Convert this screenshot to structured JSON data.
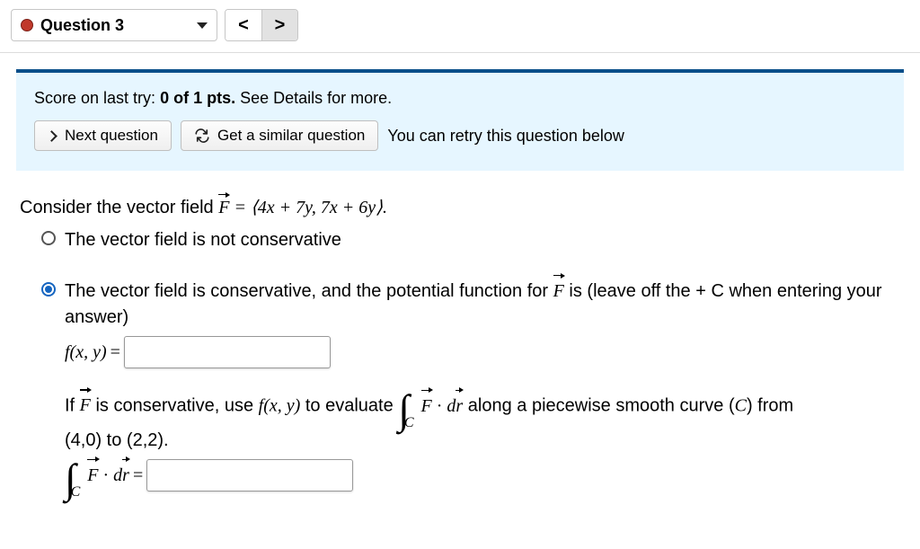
{
  "topbar": {
    "question_label": "Question 3",
    "prev": "<",
    "next": ">"
  },
  "score": {
    "prefix": "Score on last try: ",
    "value": "0 of 1 pts.",
    "suffix": " See Details for more.",
    "next_question_btn": "Next question",
    "similar_btn": "Get a similar question",
    "retry_text": "You can retry this question below"
  },
  "body": {
    "prompt_pre": "Consider the vector field ",
    "F": "F",
    "prompt_eq": " = ⟨4x + 7y, 7x + 6y⟩.",
    "opt1": "The vector field is not conservative",
    "opt2_a": "The vector field is conservative, and the potential function for ",
    "opt2_b": " is (leave off the + C when entering your answer)",
    "fxy": "f(x, y)",
    "equals": " = ",
    "ifline_a": "If ",
    "ifline_b": " is conservative, use ",
    "ifline_c": " to evaluate ",
    "Fdr": "F · dr",
    "ifline_d": " along a piecewise smooth curve (",
    "C": "C",
    "ifline_e": ") from",
    "range": "(4,0) to (2,2)."
  }
}
